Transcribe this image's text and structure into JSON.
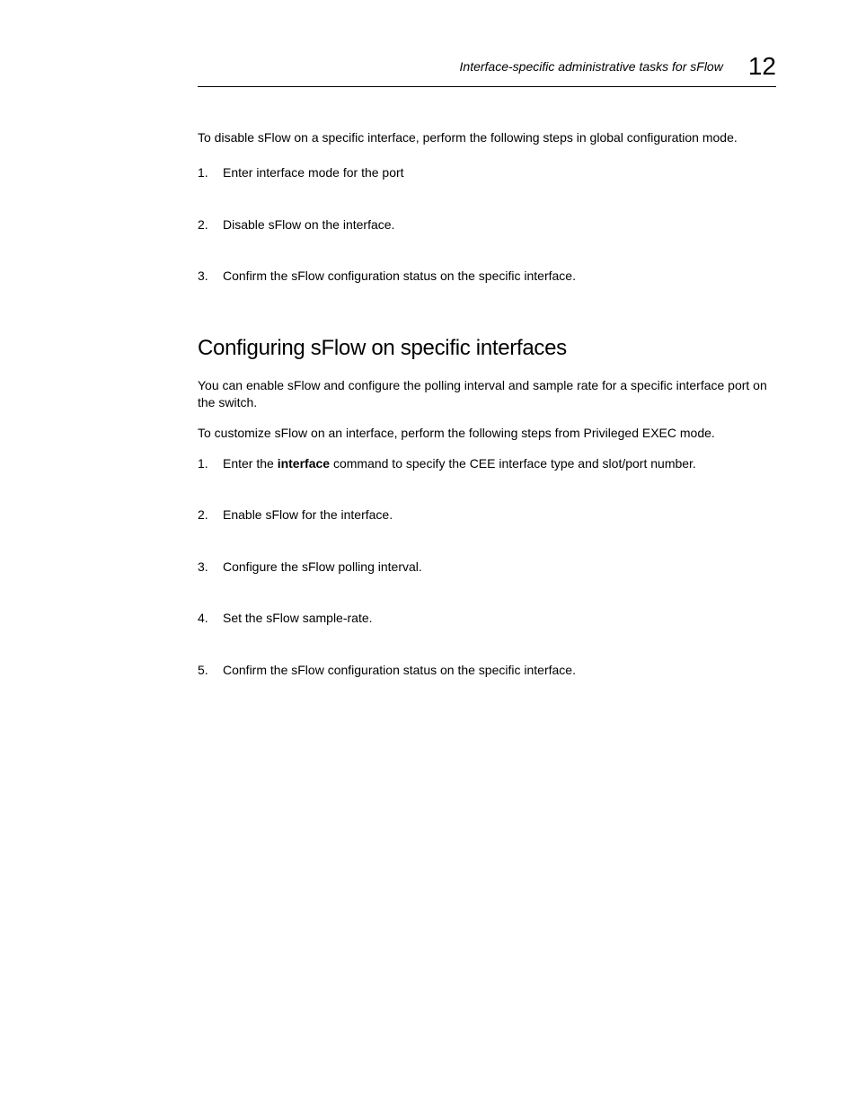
{
  "header": {
    "running_title": "Interface-specific administrative tasks for sFlow",
    "chapter_number": "12"
  },
  "sectionA": {
    "intro": "To disable sFlow on a specific interface, perform the following steps in global configuration mode.",
    "steps": [
      "Enter interface mode for the port",
      "Disable sFlow on the interface.",
      "Confirm the sFlow configuration status on the specific interface."
    ]
  },
  "sectionB": {
    "heading": "Configuring sFlow on specific interfaces",
    "p1": "You can enable sFlow and configure the polling interval and sample rate for a specific interface port on the switch.",
    "p2": "To customize sFlow on an interface, perform the following steps from Privileged EXEC mode.",
    "step1_prefix": "Enter the ",
    "step1_bold": "interface",
    "step1_suffix": " command to specify the CEE interface type and slot/port number.",
    "steps_rest": [
      "Enable sFlow for the interface.",
      "Configure the sFlow polling interval.",
      "Set the sFlow sample-rate.",
      "Confirm the sFlow configuration status on the specific interface."
    ]
  }
}
